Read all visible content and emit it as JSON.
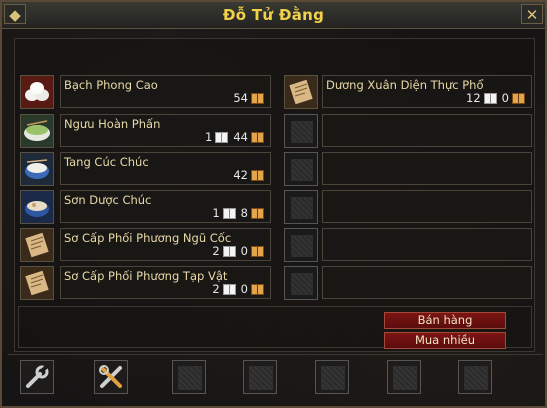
{
  "window": {
    "title": "Đỗ Tử Đằng"
  },
  "items_left": [
    {
      "name": "Bạch Phong Cao",
      "icon": "rice-cake-icon",
      "brown": "54"
    },
    {
      "name": "Ngưu Hoàn Phấn",
      "icon": "noodle-bowl-icon",
      "white": "1",
      "brown": "44"
    },
    {
      "name": "Tang Cúc Chúc",
      "icon": "porridge-bowl-icon",
      "brown": "42"
    },
    {
      "name": "Sơn Dược Chúc",
      "icon": "yam-porridge-icon",
      "white": "1",
      "brown": "8"
    },
    {
      "name": "Sơ Cấp Phối Phương Ngũ Cốc",
      "icon": "recipe-scroll-icon",
      "white": "2",
      "brown": "0"
    },
    {
      "name": "Sơ Cấp Phối Phương Tạp Vật",
      "icon": "recipe-scroll-icon",
      "white": "2",
      "brown": "0"
    }
  ],
  "items_right": [
    {
      "name": "Dương Xuân Diện Thực Phổ",
      "icon": "recipe-scroll-icon",
      "white": "12",
      "brown": "0"
    }
  ],
  "buttons": {
    "sell": "Bán hàng",
    "buy_many": "Mua nhiều"
  },
  "colors": {
    "title": "#f1d24a",
    "button_bg": "#7d1414",
    "item_text": "#e9d9a8"
  }
}
